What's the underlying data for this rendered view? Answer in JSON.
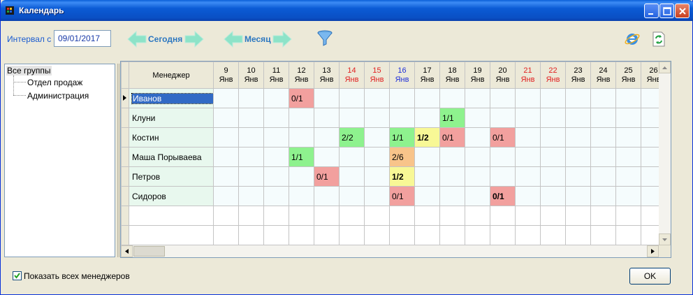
{
  "window": {
    "title": "Календарь"
  },
  "toolbar": {
    "interval_label": "Интервал с",
    "interval_value": "09/01/2017",
    "today_label": "Сегодня",
    "month_label": "Месяц",
    "filter_icon": "filter-icon",
    "ie_icon": "internet-explorer-icon",
    "refresh_icon": "refresh-icon"
  },
  "tree": {
    "root": "Все группы",
    "children": [
      "Отдел продаж",
      "Администрация"
    ]
  },
  "grid": {
    "manager_header": "Менеджер",
    "days": [
      {
        "day": "9",
        "month": "Янв",
        "type": "normal"
      },
      {
        "day": "10",
        "month": "Янв",
        "type": "normal"
      },
      {
        "day": "11",
        "month": "Янв",
        "type": "normal"
      },
      {
        "day": "12",
        "month": "Янв",
        "type": "normal"
      },
      {
        "day": "13",
        "month": "Янв",
        "type": "normal"
      },
      {
        "day": "14",
        "month": "Янв",
        "type": "weekend"
      },
      {
        "day": "15",
        "month": "Янв",
        "type": "weekend"
      },
      {
        "day": "16",
        "month": "Янв",
        "type": "today"
      },
      {
        "day": "17",
        "month": "Янв",
        "type": "normal"
      },
      {
        "day": "18",
        "month": "Янв",
        "type": "normal"
      },
      {
        "day": "19",
        "month": "Янв",
        "type": "normal"
      },
      {
        "day": "20",
        "month": "Янв",
        "type": "normal"
      },
      {
        "day": "21",
        "month": "Янв",
        "type": "weekend"
      },
      {
        "day": "22",
        "month": "Янв",
        "type": "weekend"
      },
      {
        "day": "23",
        "month": "Янв",
        "type": "normal"
      },
      {
        "day": "24",
        "month": "Янв",
        "type": "normal"
      },
      {
        "day": "25",
        "month": "Янв",
        "type": "normal"
      },
      {
        "day": "26",
        "month": "Янв",
        "type": "normal"
      }
    ],
    "rows": [
      {
        "manager": "Иванов",
        "selected": true,
        "cells": {
          "3": {
            "text": "0/1",
            "color": "red"
          }
        }
      },
      {
        "manager": "Клуни",
        "cells": {
          "9": {
            "text": "1/1",
            "color": "green"
          }
        }
      },
      {
        "manager": "Костин",
        "cells": {
          "5": {
            "text": "2/2",
            "color": "green"
          },
          "7": {
            "text": "1/1",
            "color": "green"
          },
          "8": {
            "text": "1/2",
            "color": "yellow",
            "bold": true
          },
          "9": {
            "text": "0/1",
            "color": "red"
          },
          "11": {
            "text": "0/1",
            "color": "red"
          }
        }
      },
      {
        "manager": "Маша Порываева",
        "cells": {
          "3": {
            "text": "1/1",
            "color": "green"
          },
          "7": {
            "text": "2/6",
            "color": "orange"
          }
        }
      },
      {
        "manager": "Петров",
        "cells": {
          "4": {
            "text": "0/1",
            "color": "red"
          },
          "7": {
            "text": "1/2",
            "color": "yellow",
            "bold": true
          }
        }
      },
      {
        "manager": "Сидоров",
        "cells": {
          "7": {
            "text": "0/1",
            "color": "red"
          },
          "11": {
            "text": "0/1",
            "color": "red",
            "bold": true
          }
        }
      },
      {
        "manager": "",
        "empty": true,
        "cells": {}
      },
      {
        "manager": "",
        "empty": true,
        "cells": {}
      }
    ]
  },
  "footer": {
    "show_all_label": "Показать всех менеджеров",
    "show_all_checked": true,
    "ok_label": "OK"
  }
}
